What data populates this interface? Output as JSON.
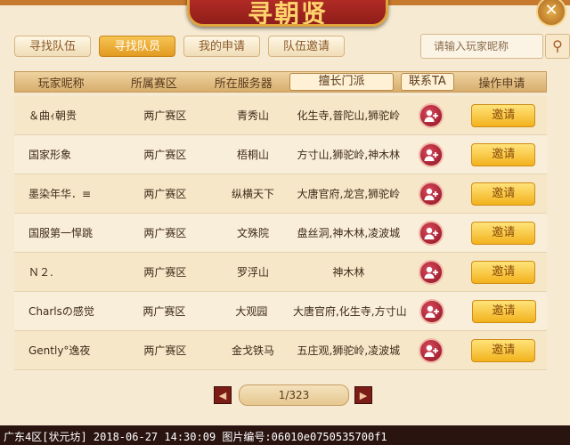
{
  "window": {
    "title": "寻朝贤"
  },
  "tabs": [
    {
      "label": "寻找队伍"
    },
    {
      "label": "寻找队员",
      "active": true
    },
    {
      "label": "我的申请"
    },
    {
      "label": "队伍邀请"
    }
  ],
  "search": {
    "placeholder": "请输入玩家昵称"
  },
  "table": {
    "columns": [
      "玩家昵称",
      "所属赛区",
      "所在服务器",
      "擅长门派",
      "联系TA",
      "操作申请"
    ],
    "rows": [
      {
        "name": "＆曲ｨ朝贵",
        "zone": "两广赛区",
        "server": "青秀山",
        "schools": "化生寺,普陀山,狮驼岭",
        "action": "邀请"
      },
      {
        "name": "国家形象",
        "zone": "两广赛区",
        "server": "梧桐山",
        "schools": "方寸山,狮驼岭,神木林",
        "action": "邀请"
      },
      {
        "name": "墨染年华．≡",
        "zone": "两广赛区",
        "server": "纵横天下",
        "schools": "大唐官府,龙宫,狮驼岭",
        "action": "邀请"
      },
      {
        "name": "国服第一悍跳",
        "zone": "两广赛区",
        "server": "文殊院",
        "schools": "盘丝洞,神木林,凌波城",
        "action": "邀请"
      },
      {
        "name": "Ｎ２.",
        "zone": "两广赛区",
        "server": "罗浮山",
        "schools": "神木林",
        "action": "邀请"
      },
      {
        "name": "Charlsの感觉",
        "zone": "两广赛区",
        "server": "大观园",
        "schools": "大唐官府,化生寺,方寸山",
        "action": "邀请"
      },
      {
        "name": "Gently°逸夜",
        "zone": "两广赛区",
        "server": "金戈铁马",
        "schools": "五庄观,狮驼岭,凌波城",
        "action": "邀请"
      }
    ]
  },
  "pager": {
    "text": "1/323"
  },
  "footer": {
    "watermark": "广东4区[状元坊] 2018-06-27 14:30:09 图片编号:06010e0750535700f1"
  },
  "icons": {
    "close": "close-icon",
    "search": "search-icon",
    "add_friend": "add-friend-icon",
    "prev": "prev-page-icon",
    "next": "next-page-icon"
  },
  "colors": {
    "accent": "#e29a20",
    "panel": "#f7ead2",
    "contact": "#a31a2b"
  }
}
